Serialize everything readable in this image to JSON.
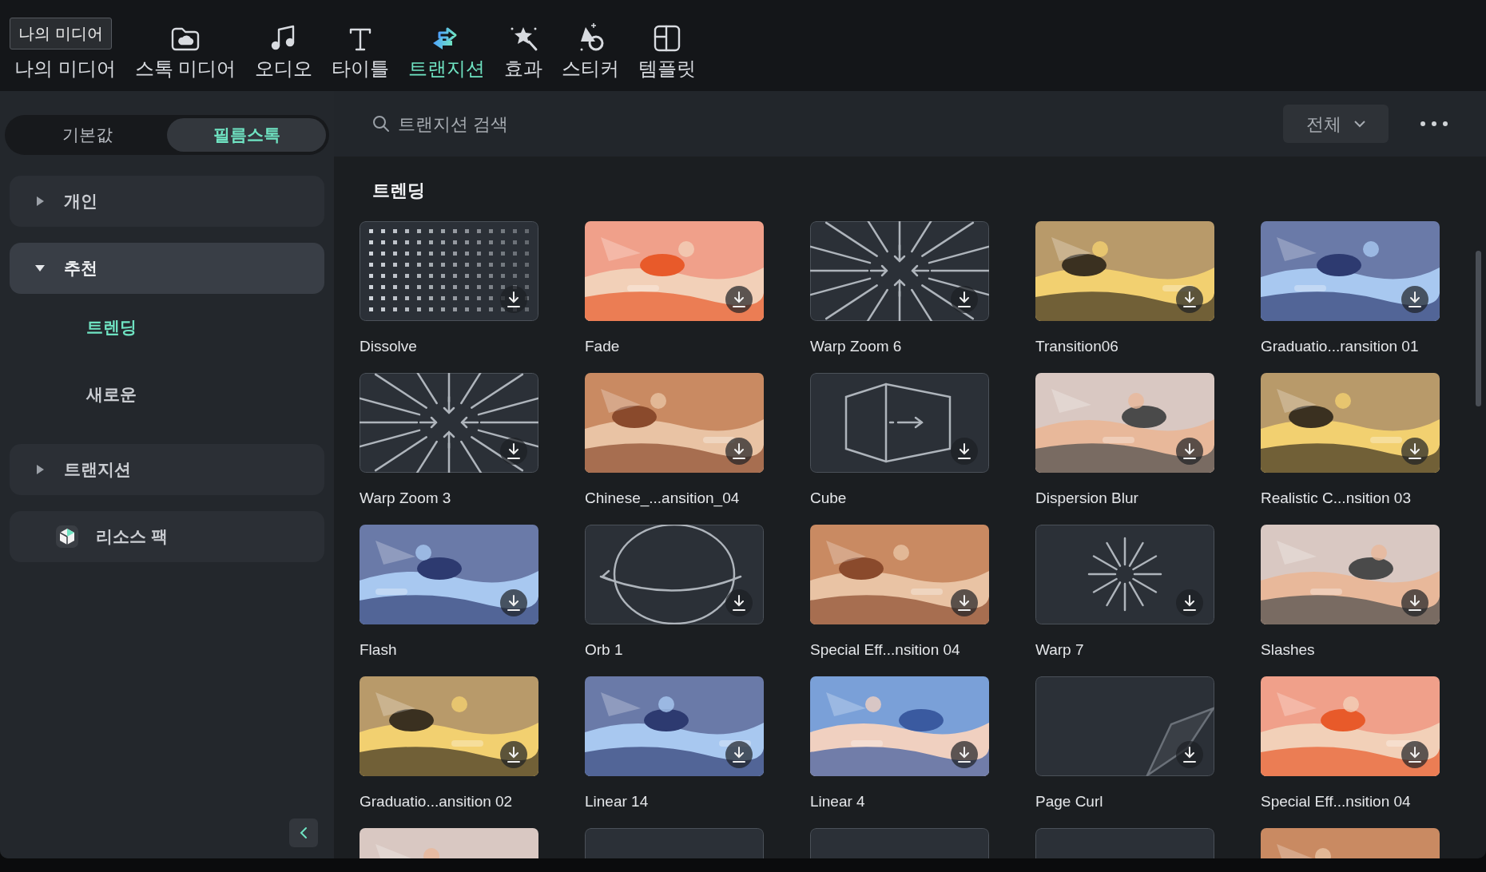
{
  "toolbar": {
    "tabs": [
      {
        "label": "나의 미디어",
        "selected": false
      },
      {
        "label": "스톡 미디어",
        "selected": false
      },
      {
        "label": "오디오",
        "selected": false
      },
      {
        "label": "타이틀",
        "selected": false
      },
      {
        "label": "트랜지션",
        "selected": true
      },
      {
        "label": "효과",
        "selected": false
      },
      {
        "label": "스티커",
        "selected": false
      },
      {
        "label": "템플릿",
        "selected": false
      }
    ],
    "tooltip": "나의 미디어"
  },
  "sidebar": {
    "segments": [
      {
        "label": "기본값",
        "selected": false
      },
      {
        "label": "필름스톡",
        "selected": true
      }
    ],
    "items": [
      {
        "label": "개인",
        "kind": "group",
        "expanded": false,
        "selected": false
      },
      {
        "label": "추천",
        "kind": "group",
        "expanded": true,
        "selected": true,
        "children": [
          {
            "label": "트렌딩",
            "selected": true
          },
          {
            "label": "새로운",
            "selected": false
          }
        ]
      },
      {
        "label": "트랜지션",
        "kind": "group",
        "expanded": false,
        "selected": false
      },
      {
        "label": "리소스 팩",
        "kind": "pack",
        "selected": false
      }
    ]
  },
  "search": {
    "placeholder": "트랜지션 검색"
  },
  "filter": {
    "value": "전체"
  },
  "section_title": "트렌딩",
  "tiles": [
    {
      "name": "Dissolve",
      "kind": "dots"
    },
    {
      "name": "Fade",
      "kind": "picture"
    },
    {
      "name": "Warp Zoom 6",
      "kind": "burst"
    },
    {
      "name": "Transition06",
      "kind": "picture"
    },
    {
      "name": "Graduatio...ransition 01",
      "kind": "picture"
    },
    {
      "name": "Warp Zoom 3",
      "kind": "burst"
    },
    {
      "name": "Chinese_...ansition_04",
      "kind": "picture"
    },
    {
      "name": "Cube",
      "kind": "cube"
    },
    {
      "name": "Dispersion Blur",
      "kind": "picture"
    },
    {
      "name": "Realistic C...nsition 03",
      "kind": "picture"
    },
    {
      "name": "Flash",
      "kind": "picture"
    },
    {
      "name": "Orb 1",
      "kind": "orb"
    },
    {
      "name": "Special Eff...nsition 04",
      "kind": "picture"
    },
    {
      "name": "Warp 7",
      "kind": "star"
    },
    {
      "name": "Slashes",
      "kind": "picture"
    },
    {
      "name": "Graduatio...ansition 02",
      "kind": "picture"
    },
    {
      "name": "Linear 14",
      "kind": "picture"
    },
    {
      "name": "Linear 4",
      "kind": "picture"
    },
    {
      "name": "Page Curl",
      "kind": "curl"
    },
    {
      "name": "Special Eff...nsition 04",
      "kind": "picture"
    },
    {
      "kind": "picture"
    },
    {
      "kind": "plain"
    },
    {
      "kind": "plain"
    },
    {
      "kind": "plain"
    },
    {
      "kind": "picture"
    }
  ]
}
